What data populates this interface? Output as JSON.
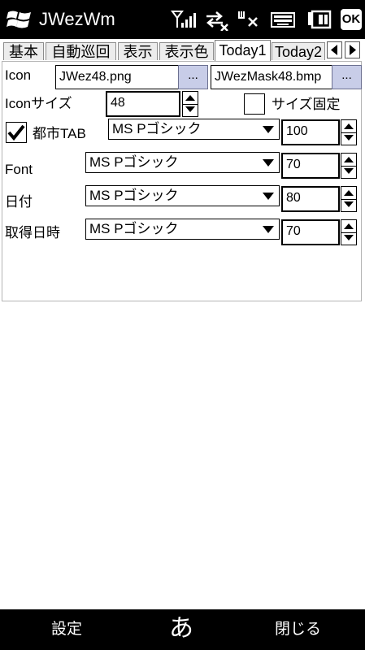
{
  "titlebar": {
    "app_title": "JWezWm",
    "ok_label": "OK"
  },
  "tabs": [
    {
      "label": "基本",
      "active": false
    },
    {
      "label": "自動巡回",
      "active": false
    },
    {
      "label": "表示",
      "active": false
    },
    {
      "label": "表示色",
      "active": false
    },
    {
      "label": "Today1",
      "active": true
    },
    {
      "label": "Today2",
      "active": false
    }
  ],
  "form": {
    "icon": {
      "label": "Icon",
      "file": "JWez48.png",
      "browse1_label": "...",
      "mask_file": "JWezMask48.bmp",
      "browse2_label": "..."
    },
    "icon_size": {
      "label": "Iconサイズ",
      "value": "48",
      "fixed_label": "サイズ固定",
      "fixed_checked": false
    },
    "city_tab": {
      "label": "都市TAB",
      "checked": true,
      "font": "MS Pゴシック",
      "size": "100"
    },
    "font": {
      "label": "Font",
      "font": "MS Pゴシック",
      "size": "70"
    },
    "date": {
      "label": "日付",
      "font": "MS Pゴシック",
      "size": "80"
    },
    "fetch_time": {
      "label": "取得日時",
      "font": "MS Pゴシック",
      "size": "70"
    }
  },
  "bottombar": {
    "left_softkey": "設定",
    "ime_label": "あ",
    "right_softkey": "閉じる"
  },
  "colors": {
    "bar_background": "#000000",
    "browse_button": "#c8cde8",
    "panel_border": "#b4b4b4"
  }
}
